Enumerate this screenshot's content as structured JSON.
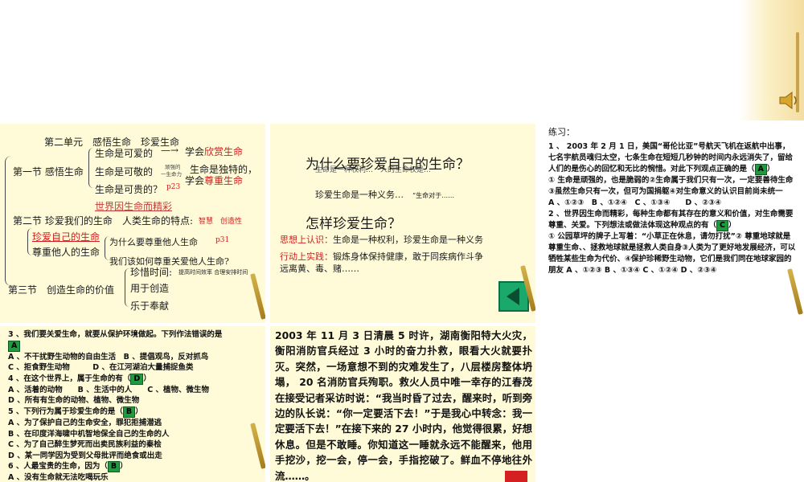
{
  "icons": {
    "speaker": "speaker-icon",
    "nav": "play-triangle-icon",
    "back": "back-arrow-icon"
  },
  "colors": {
    "accent_red": "#d01c1c",
    "panel_bg": "#fffbd9",
    "answer_green": "#1f9a3f",
    "nav_green": "#1aa86b"
  },
  "panel1": {
    "unit": "第二单元　感悟生命　珍爱生命",
    "sec1": "第一节 感悟生命",
    "life_lovely": "生命是可爱的",
    "learn_appreciate_prefix": "学会",
    "appreciate": "欣赏生命",
    "life_precious": "生命是可敬的",
    "small_note1": "顽强的",
    "small_note2": "一生命力",
    "unique": "生命是独特的，",
    "learn_respect_prefix": "学会",
    "respect": "尊重生命",
    "life_valuable": "生命是可贵的？",
    "p23": "p23",
    "world_day": "世界因生命而精彩",
    "sec2": "第二节 珍爱我们的生命",
    "human_traits": "人类生命的特点:",
    "traits": "智慧　创造性",
    "cherish_self": "珍爱自己的生命",
    "respect_others": "尊重他人的生命",
    "why_respect": "为什么要尊重他人生命",
    "p31": "p31",
    "how_respect": "我们该如何尊重关爱他人生命?",
    "sec3": "第三节　创造生命的价值",
    "cherish_time": "珍惜时间:",
    "time_note": "提高时间效率 合理安排时间",
    "create": "用于创造",
    "dedicate": "乐于奉献"
  },
  "panel2": {
    "q1": "为什么要珍爱自己的生命？",
    "ghost": "生命是一种权利…　人的生命权是…",
    "duty": "珍爱生命是一种义务…",
    "duty_note": "“生命对于……",
    "q2": "怎样珍爱生命？",
    "think_label": "思想上认识：",
    "think_text": "生命是一种权利，珍爱生命是一种义务",
    "act_label": "行动上实践：",
    "act_text": "锻炼身体保持健康，敢于同疾病作斗争",
    "act_text2": "远离黄、毒、赌……"
  },
  "panel3": {
    "head": "练习：",
    "q1": "1 、 2003 年 2 月 1 日，美国“哥伦比亚”号航天飞机在返航中出事，七名宇航员魂归太空，七条生命在短短几秒钟的时间内永远消失了，留给人们的是伤心的回忆和无比的惋惜。对此下列观点正确的是（",
    "q1_ans": "A",
    "q1_close": "）",
    "q1_opts": "① 生命是顽强的，也是脆弱的②生命属于我们只有一次，一定要善待生命③虽然生命只有一次，但可为国捐躯④对生命意义的认识目前尚未统一",
    "q1_choices": "A 、①②③　B 、①②④　C 、①③④　　D 、②③④",
    "q2": "2 、世界因生命而精彩，每种生命都有其存在的意义和价值，对生命需要尊重、关爱。下列想法或做法体现这种观点的有（",
    "q2_ans": "C",
    "q2_close": "）",
    "q2_opts": "① 公园草坪的牌子上写着：“小草正在休息，请勿打扰”② 尊重地球就是尊重生命、、拯救地球就是拯救人类自身③人类为了更好地发展经济，可以牺牲某些生命为代价、④保护珍稀野生动物，它们是我们同在地球家园的朋友 A 、①②③ B 、①③④ C 、①②④ D 、②③④"
  },
  "panel4": {
    "q3": "3 、我们要关爱生命，就要从保护环境做起。下列作法错误的是",
    "q3_ans": "A",
    "q3_a": "A 、不干扰野生动物的自由生活　B 、提倡观鸟，反对抓鸟",
    "q3_c": "C 、拒食野生动物　　　D 、在江河湖泊大量捕捉鱼类",
    "q4": "4 、在这个世界上，属于生命的有（",
    "q4_ans": "D",
    "q4_close": "）",
    "q4_a": "A 、活着的动物　　B 、生活中的人　　C 、植物、微生物",
    "q4_d": "D 、所有有生命的动物、植物、微生物",
    "q5": "5 、下列行为属于珍爱生命的是（",
    "q5_ans": "B",
    "q5_close": "）",
    "q5_a": "A 、为了保护自己的生命安全，罪犯拒捕潜逃",
    "q5_b": "B 、在印度洋海啸中机智地保全自己的生命的人",
    "q5_c": "C 、为了自己醉生梦死而出卖民族利益的秦桧",
    "q5_d": "D 、某一同学因为受到父母批评而绝食或出走",
    "q6": "6 、人最宝贵的生命，因为（",
    "q6_ans": "B",
    "q6_close": "）",
    "q6_a": "A 、没有生命就无法吃喝玩乐"
  },
  "panel5": {
    "story": "2003 年 11 月 3 日清晨 5 时许，湖南衡阳特大火灾，衡阳消防官兵经过 3 小时的奋力扑救，眼看大火就要扑灭。突然，一场意想不到的灾难发生了，八层楼房整体坍塌， 20 名消防官兵殉职。救火人员中唯一幸存的江春茂在接受记者采访时说：“我当时昏了过去，醒来时，听到旁边的队长说：“你一定要活下去！”于是我心中转念：我一定要活下去！”在接下来的 27 小时内，他觉得很累，好想休息。但是不敢睡。你知道这一睡就永远不能醒来，他用手挖沙，挖一会，停一会，手指挖破了。鲜血不停地往外流……。"
  }
}
